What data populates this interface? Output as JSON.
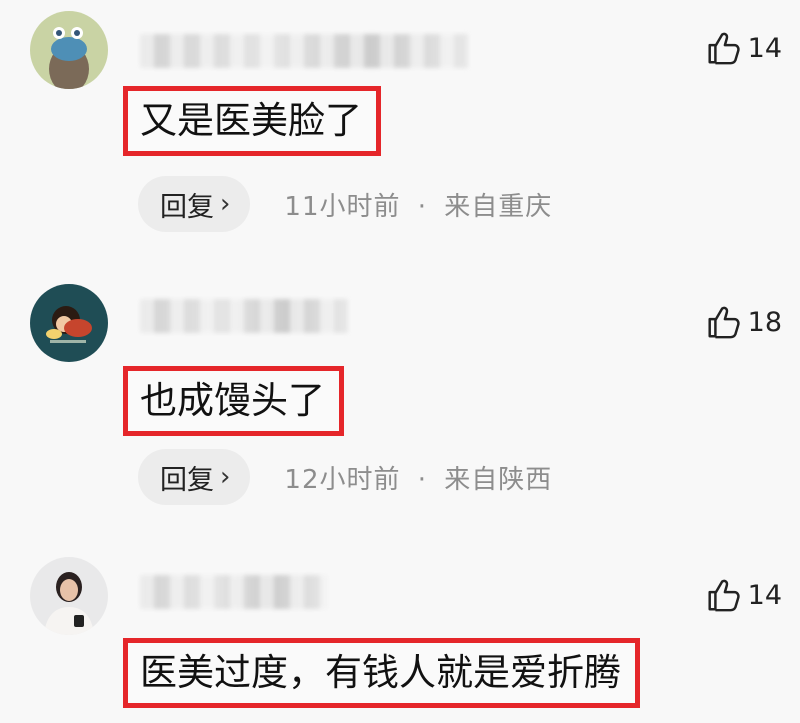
{
  "comments": [
    {
      "likes": "14",
      "text": "又是医美脸了",
      "reply_label": "回复",
      "time": "11小时前",
      "separator": "·",
      "location": "来自重庆"
    },
    {
      "likes": "18",
      "text": "也成馒头了",
      "reply_label": "回复",
      "time": "12小时前",
      "separator": "·",
      "location": "来自陕西"
    },
    {
      "likes": "14",
      "text": "医美过度，有钱人就是爱折腾"
    }
  ],
  "colors": {
    "highlight_border": "#e5262a",
    "meta_text": "#8d8d8d",
    "reply_bg": "#ececec"
  },
  "icons": {
    "like": "thumbs-up-icon",
    "reply": "chevron-right-icon"
  }
}
